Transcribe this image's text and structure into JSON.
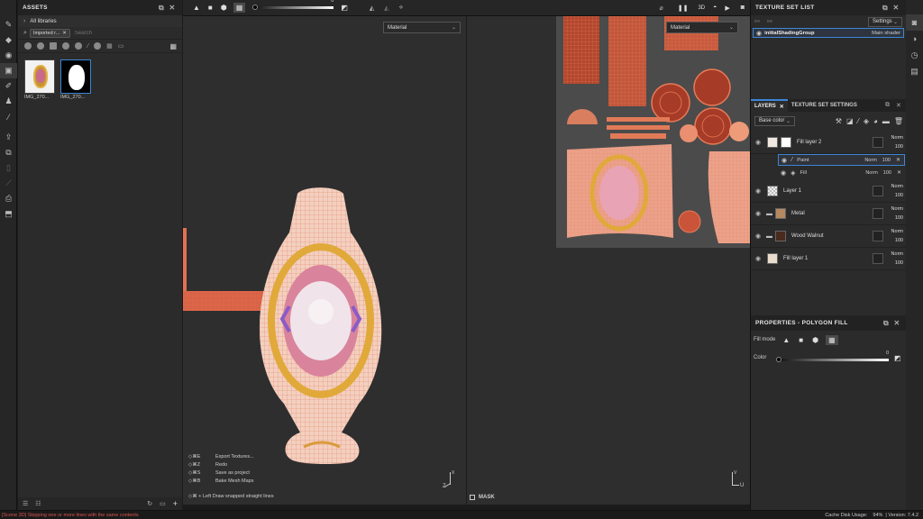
{
  "assets": {
    "title": "ASSETS",
    "breadcrumb": "All libraries",
    "filter_chip": "Imported r...",
    "search_placeholder": "Search",
    "items": [
      {
        "label": "IMG_270..."
      },
      {
        "label": "IMG_270..."
      }
    ]
  },
  "toolbar": {
    "slider_value": "0"
  },
  "viewport3d": {
    "shortcuts": [
      {
        "keys": "◇⌘E",
        "action": "Export Textures..."
      },
      {
        "keys": "◇⌘Z",
        "action": "Redo"
      },
      {
        "keys": "◇⌘S",
        "action": "Save as project"
      },
      {
        "keys": "◇⌘B",
        "action": "Bake Mesh Maps"
      }
    ],
    "hint": "◇⌘ + Left  Draw snapped straight lines",
    "axis_z": "Z",
    "axis_x": "X"
  },
  "viewport2d": {
    "material_dropdown": "Material",
    "material_dropdown_top": "Material",
    "mask_label": "MASK",
    "axis_u": "U",
    "axis_v": "V"
  },
  "texture_set_list": {
    "title": "TEXTURE SET LIST",
    "settings_label": "Settings",
    "item_name": "initialShadingGroup",
    "item_shader": "Main shader"
  },
  "layers": {
    "tab_layers": "LAYERS",
    "tab_tss": "TEXTURE SET SETTINGS",
    "channel": "Base color",
    "rows": [
      {
        "name": "Fill layer 2",
        "blend": "Norm",
        "opacity": "100"
      },
      {
        "name": "Paint",
        "blend": "Norm",
        "opacity": "100"
      },
      {
        "name": "Fill",
        "blend": "Norm",
        "opacity": "100"
      },
      {
        "name": "Layer 1",
        "blend": "Norm",
        "opacity": "100"
      },
      {
        "name": "Metal",
        "blend": "Norm",
        "opacity": "100"
      },
      {
        "name": "Wood Walnut",
        "blend": "Norm",
        "opacity": "100"
      },
      {
        "name": "Fill layer 1",
        "blend": "Norm",
        "opacity": "100"
      }
    ]
  },
  "properties": {
    "title": "PROPERTIES - POLYGON FILL",
    "fill_mode_label": "Fill mode",
    "color_label": "Color",
    "color_value": "0"
  },
  "status": {
    "message": "[Scene 3D] Skipping one or more lines with the same contents",
    "cache_label": "Cache Disk Usage:",
    "cache_value": "94%",
    "version": "| Version: 7.4.2"
  },
  "colors": {
    "accent": "#3d86d6",
    "status_error": "#d9534f",
    "mesh": "#e36f52"
  }
}
